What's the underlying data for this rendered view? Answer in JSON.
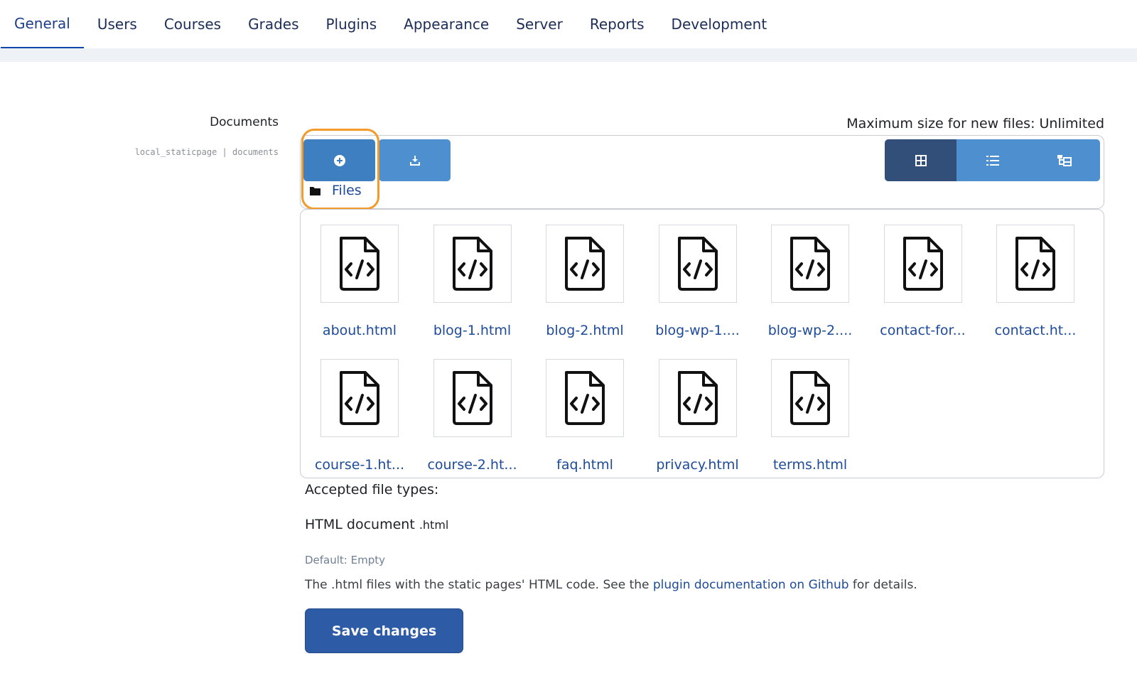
{
  "tabs": [
    {
      "label": "General",
      "active": true
    },
    {
      "label": "Users"
    },
    {
      "label": "Courses"
    },
    {
      "label": "Grades"
    },
    {
      "label": "Plugins"
    },
    {
      "label": "Appearance"
    },
    {
      "label": "Server"
    },
    {
      "label": "Reports"
    },
    {
      "label": "Development"
    }
  ],
  "setting": {
    "label": "Documents",
    "key": "local_staticpage | documents"
  },
  "filepicker": {
    "max_size": "Maximum size for new files: Unlimited",
    "add_icon": "plus-circle-icon",
    "download_icon": "download-icon",
    "views": [
      {
        "icon": "grid-icon",
        "active": true
      },
      {
        "icon": "list-icon"
      },
      {
        "icon": "tree-icon"
      }
    ],
    "path_label": "Files",
    "files": [
      "about.html",
      "blog-1.html",
      "blog-2.html",
      "blog-wp-1....",
      "blog-wp-2....",
      "contact-for...",
      "contact.ht...",
      "course-1.ht...",
      "course-2.ht...",
      "faq.html",
      "privacy.html",
      "terms.html"
    ]
  },
  "accepted": {
    "label": "Accepted file types:",
    "type_name": "HTML document",
    "type_ext": ".html"
  },
  "default_text": "Default: Empty",
  "description": {
    "before": "The .html files with the static pages' HTML code. See the ",
    "link": "plugin documentation on Github",
    "after": " for details."
  },
  "save_label": "Save changes",
  "colors": {
    "primary": "#2d5ba6",
    "button": "#4e8fd0",
    "highlight": "#f39b2a"
  }
}
